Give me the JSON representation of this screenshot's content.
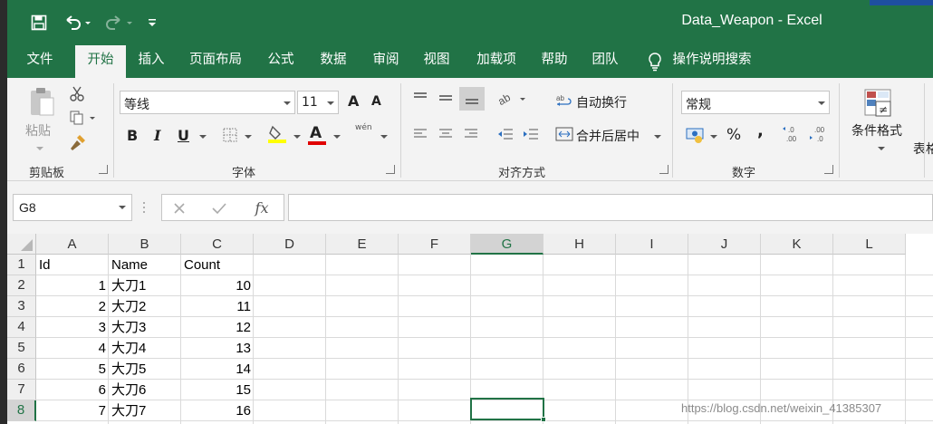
{
  "window": {
    "title": "Data_Weapon  -  Excel"
  },
  "tabs": [
    "文件",
    "开始",
    "插入",
    "页面布局",
    "公式",
    "数据",
    "审阅",
    "视图",
    "加载项",
    "帮助",
    "团队",
    "操作说明搜索"
  ],
  "ribbon": {
    "clipboard": {
      "paste_label": "粘贴",
      "group_label": "剪贴板"
    },
    "font": {
      "name": "等线",
      "size": "11",
      "group_label": "字体",
      "phonetic_char": "wén",
      "grow_char": "A",
      "shrink_char": "A",
      "bold_char": "B",
      "italic_char": "I",
      "underline_char": "U",
      "font_color_char": "A"
    },
    "alignment": {
      "wrap_text": "自动换行",
      "merge_center": "合并后居中",
      "group_label": "对齐方式"
    },
    "number": {
      "format": "常规",
      "percent": "%",
      "comma": ",",
      "group_label": "数字"
    },
    "styles": {
      "conditional_format": "条件格式",
      "table_format_partial": "表格"
    }
  },
  "formula_bar": {
    "name_box": "G8",
    "formula": "",
    "fx_label": "fx"
  },
  "sheet": {
    "columns": [
      "A",
      "B",
      "C",
      "D",
      "E",
      "F",
      "G",
      "H",
      "I",
      "J",
      "K",
      "L"
    ],
    "rows": [
      "1",
      "2",
      "3",
      "4",
      "5",
      "6",
      "7",
      "8"
    ],
    "selected_cell": "G8",
    "headers": {
      "A1": "Id",
      "B1": "Name",
      "C1": "Count"
    },
    "data": [
      {
        "id": "1",
        "name": "大刀1",
        "count": "10"
      },
      {
        "id": "2",
        "name": "大刀2",
        "count": "11"
      },
      {
        "id": "3",
        "name": "大刀3",
        "count": "12"
      },
      {
        "id": "4",
        "name": "大刀4",
        "count": "13"
      },
      {
        "id": "5",
        "name": "大刀5",
        "count": "14"
      },
      {
        "id": "6",
        "name": "大刀6",
        "count": "15"
      },
      {
        "id": "7",
        "name": "大刀7",
        "count": "16"
      }
    ]
  },
  "watermark": "https://blog.csdn.net/weixin_41385307",
  "colors": {
    "excel_green": "#217346",
    "ribbon_bg": "#f3f3f3"
  }
}
